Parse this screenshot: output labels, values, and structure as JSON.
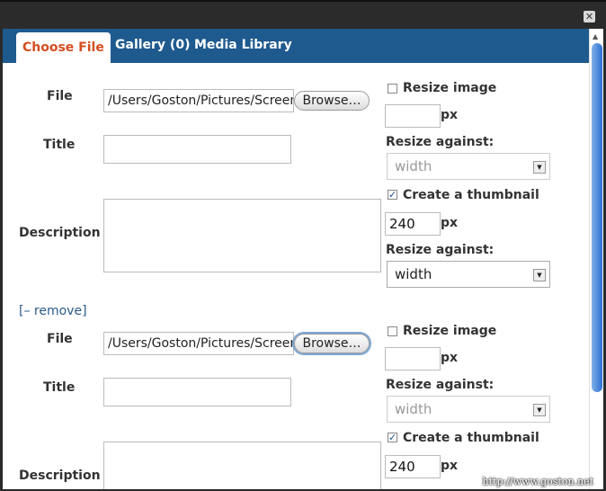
{
  "tabs": {
    "choose_file": "Choose File",
    "gallery": "Gallery (0)",
    "media_library": "Media Library"
  },
  "close_icon": "✕",
  "entries": [
    {
      "file_label": "File",
      "file_value": "/Users/Goston/Pictures/Screen",
      "browse_label": "Browse…",
      "title_label": "Title",
      "description_label": "Description",
      "resize_label": "Resize image",
      "resize_checked": false,
      "resize_value": "",
      "px": "px",
      "resize_against_label": "Resize against:",
      "resize_against_value": "width",
      "thumb_label": "Create a thumbnail",
      "thumb_checked": true,
      "thumb_value": "240",
      "thumb_against_label": "Resize against:",
      "thumb_against_value": "width"
    },
    {
      "file_label": "File",
      "file_value": "/Users/Goston/Pictures/Screen",
      "browse_label": "Browse…",
      "title_label": "Title",
      "description_label": "Description",
      "resize_label": "Resize image",
      "resize_checked": false,
      "resize_value": "",
      "px": "px",
      "resize_against_label": "Resize against:",
      "resize_against_value": "width",
      "thumb_label": "Create a thumbnail",
      "thumb_checked": true,
      "thumb_value": "240"
    }
  ],
  "remove_link": {
    "open": "[–",
    "text": "remove",
    "close": "]"
  },
  "watermark": "http://www.goston.net",
  "colors": {
    "tabbar": "#1f5a8f",
    "active_tab_text": "#d54e21",
    "link": "#2a5a8a"
  }
}
